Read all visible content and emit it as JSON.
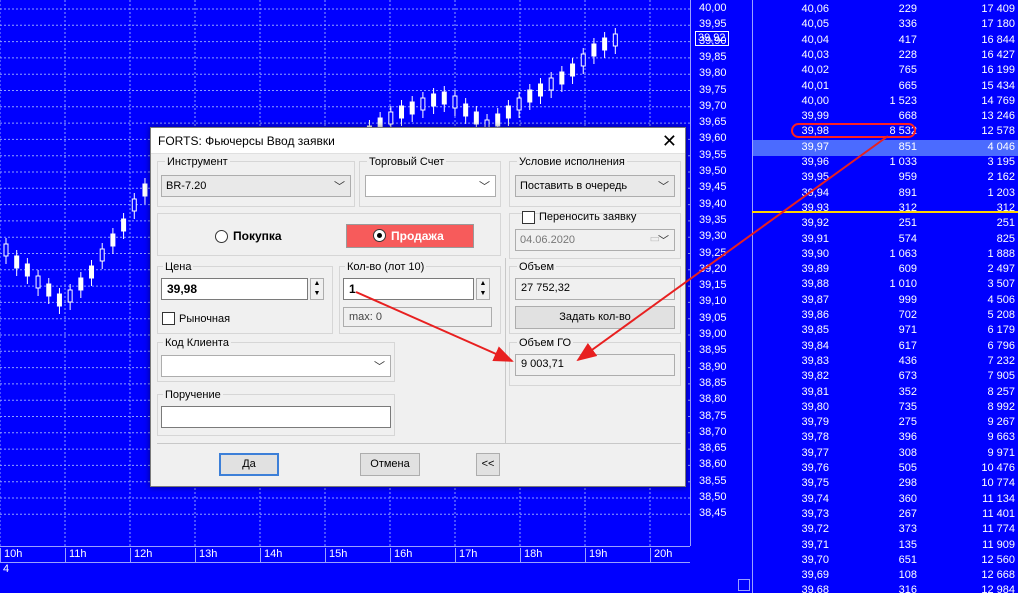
{
  "chart": {
    "price_ticks": [
      "40,00",
      "39,95",
      "39,90",
      "39,85",
      "39,80",
      "39,75",
      "39,70",
      "39,65",
      "39,60",
      "39,55",
      "39,50",
      "39,45",
      "39,40",
      "39,35",
      "39,30",
      "39,25",
      "39,20",
      "39,15",
      "39,10",
      "39,05",
      "39,00",
      "38,95",
      "38,90",
      "38,85",
      "38,80",
      "38,75",
      "38,70",
      "38,65",
      "38,60",
      "38,55",
      "38,50",
      "38,45"
    ],
    "current_price": "39,92",
    "time_ticks": [
      "10h",
      "11h",
      "12h",
      "13h",
      "14h",
      "15h",
      "16h",
      "17h",
      "18h",
      "19h",
      "20h"
    ],
    "bottom_label": "4",
    "colors": {
      "background": "#0000ff",
      "candles": "#ffffff",
      "grid": "#8fa0ff"
    }
  },
  "order_book": {
    "rows": [
      {
        "price": "40,06",
        "volume": "229",
        "cumulative": "17 409"
      },
      {
        "price": "40,05",
        "volume": "336",
        "cumulative": "17 180"
      },
      {
        "price": "40,04",
        "volume": "417",
        "cumulative": "16 844"
      },
      {
        "price": "40,03",
        "volume": "228",
        "cumulative": "16 427"
      },
      {
        "price": "40,02",
        "volume": "765",
        "cumulative": "16 199"
      },
      {
        "price": "40,01",
        "volume": "665",
        "cumulative": "15 434"
      },
      {
        "price": "40,00",
        "volume": "1 523",
        "cumulative": "14 769"
      },
      {
        "price": "39,99",
        "volume": "668",
        "cumulative": "13 246"
      },
      {
        "price": "39,98",
        "volume": "8 532",
        "cumulative": "12 578"
      },
      {
        "price": "39,97",
        "volume": "851",
        "cumulative": "4 046"
      },
      {
        "price": "39,96",
        "volume": "1 033",
        "cumulative": "3 195"
      },
      {
        "price": "39,95",
        "volume": "959",
        "cumulative": "2 162"
      },
      {
        "price": "39,94",
        "volume": "891",
        "cumulative": "1 203"
      },
      {
        "price": "39,93",
        "volume": "312",
        "cumulative": "312"
      },
      {
        "price": "39,92",
        "volume": "251",
        "cumulative": "251"
      },
      {
        "price": "39,91",
        "volume": "574",
        "cumulative": "825"
      },
      {
        "price": "39,90",
        "volume": "1 063",
        "cumulative": "1 888"
      },
      {
        "price": "39,89",
        "volume": "609",
        "cumulative": "2 497"
      },
      {
        "price": "39,88",
        "volume": "1 010",
        "cumulative": "3 507"
      },
      {
        "price": "39,87",
        "volume": "999",
        "cumulative": "4 506"
      },
      {
        "price": "39,86",
        "volume": "702",
        "cumulative": "5 208"
      },
      {
        "price": "39,85",
        "volume": "971",
        "cumulative": "6 179"
      },
      {
        "price": "39,84",
        "volume": "617",
        "cumulative": "6 796"
      },
      {
        "price": "39,83",
        "volume": "436",
        "cumulative": "7 232"
      },
      {
        "price": "39,82",
        "volume": "673",
        "cumulative": "7 905"
      },
      {
        "price": "39,81",
        "volume": "352",
        "cumulative": "8 257"
      },
      {
        "price": "39,80",
        "volume": "735",
        "cumulative": "8 992"
      },
      {
        "price": "39,79",
        "volume": "275",
        "cumulative": "9 267"
      },
      {
        "price": "39,78",
        "volume": "396",
        "cumulative": "9 663"
      },
      {
        "price": "39,77",
        "volume": "308",
        "cumulative": "9 971"
      },
      {
        "price": "39,76",
        "volume": "505",
        "cumulative": "10 476"
      },
      {
        "price": "39,75",
        "volume": "298",
        "cumulative": "10 774"
      },
      {
        "price": "39,74",
        "volume": "360",
        "cumulative": "11 134"
      },
      {
        "price": "39,73",
        "volume": "267",
        "cumulative": "11 401"
      },
      {
        "price": "39,72",
        "volume": "373",
        "cumulative": "11 774"
      },
      {
        "price": "39,71",
        "volume": "135",
        "cumulative": "11 909"
      },
      {
        "price": "39,70",
        "volume": "651",
        "cumulative": "12 560"
      },
      {
        "price": "39,69",
        "volume": "108",
        "cumulative": "12 668"
      },
      {
        "price": "39,68",
        "volume": "316",
        "cumulative": "12 984"
      }
    ],
    "colors": {
      "best_row": "#4b6bff",
      "spread_line": "#ffd400",
      "highlight": "#ff2020"
    }
  },
  "dialog": {
    "title": "FORTS: Фьючерсы Ввод заявки",
    "instrument_label": "Инструмент",
    "instrument_value": "BR-7.20",
    "account_label": "Торговый Счет",
    "account_value": "",
    "condition_label": "Условие исполнения",
    "condition_value": "Поставить в очередь",
    "buy_label": "Покупка",
    "sell_label": "Продажа",
    "sell_color": "#f75b5b",
    "move_order_label": "Переносить заявку",
    "move_order_date": "04.06.2020",
    "price_label": "Цена",
    "price_value": "39,98",
    "qty_label": "Кол-во (лот 10)",
    "qty_value": "1",
    "max_label": "max: 0",
    "market_label": "Рыночная",
    "volume_label": "Объем",
    "volume_value": "27 752,32",
    "set_qty_button": "Задать кол-во",
    "client_code_label": "Код Клиента",
    "client_code_value": "",
    "go_volume_label": "Объем ГО",
    "go_volume_value": "9 003,71",
    "instruction_label": "Поручение",
    "instruction_value": "",
    "ok_button": "Да",
    "cancel_button": "Отмена",
    "collapse_button": "<<"
  }
}
